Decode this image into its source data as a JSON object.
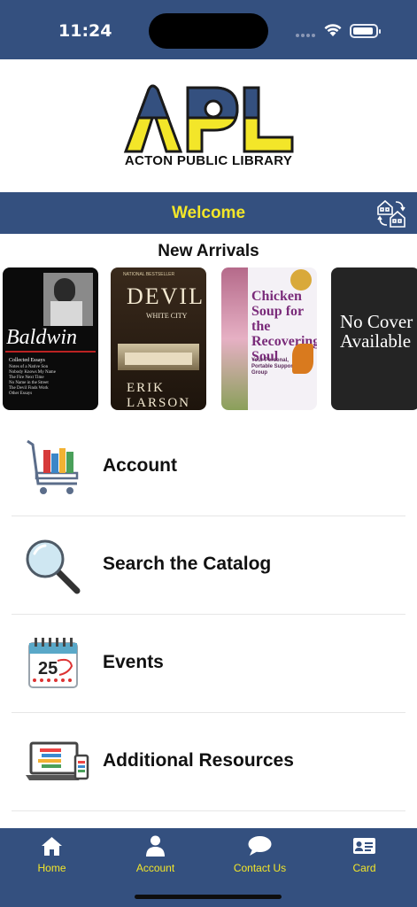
{
  "status_bar": {
    "time": "11:24"
  },
  "logo": {
    "letters": "APL",
    "name": "ACTON PUBLIC LIBRARY"
  },
  "header": {
    "title": "Welcome",
    "icon": "branch-switch-icon"
  },
  "new_arrivals": {
    "title": "New Arrivals",
    "books": [
      {
        "title": "Baldwin",
        "subtitle": "Collected Essays",
        "lines": [
          "Notes of a Native Son",
          "Nobody Knows My Name",
          "The Fire Next Time",
          "No Name in the Street",
          "The Devil Finds Work",
          "Other Essays"
        ]
      },
      {
        "top": "NATIONAL BESTSELLER",
        "title": "DEVIL",
        "subtitle": "WHITE CITY",
        "author": "ERIK LARSON"
      },
      {
        "title": "Chicken Soup for the Recovering Soul",
        "subtitle": "Your Personal, Portable Support Group"
      },
      {
        "title": "No Cover Available"
      }
    ]
  },
  "menu": [
    {
      "label": "Account",
      "icon": "shopping-cart-books-icon"
    },
    {
      "label": "Search the Catalog",
      "icon": "magnifying-glass-icon"
    },
    {
      "label": "Events",
      "icon": "calendar-icon",
      "icon_text": "25"
    },
    {
      "label": "Additional Resources",
      "icon": "devices-icon"
    }
  ],
  "tabs": [
    {
      "label": "Home",
      "icon": "home-icon"
    },
    {
      "label": "Account",
      "icon": "person-icon"
    },
    {
      "label": "Contact Us",
      "icon": "chat-bubble-icon"
    },
    {
      "label": "Card",
      "icon": "id-card-icon"
    }
  ],
  "colors": {
    "navy": "#34507f",
    "yellow": "#f3e629"
  }
}
